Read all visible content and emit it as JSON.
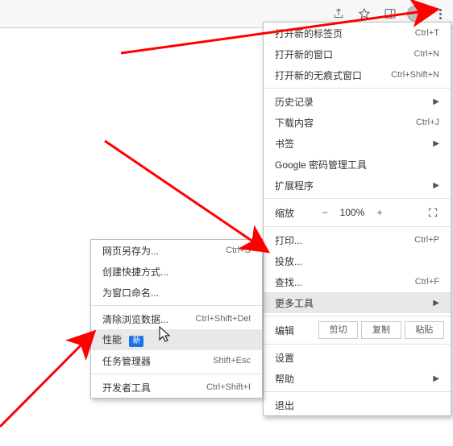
{
  "menu": {
    "new_tab": {
      "label": "打开新的标签页",
      "shortcut": "Ctrl+T"
    },
    "new_window": {
      "label": "打开新的窗口",
      "shortcut": "Ctrl+N"
    },
    "incognito": {
      "label": "打开新的无痕式窗口",
      "shortcut": "Ctrl+Shift+N"
    },
    "history": {
      "label": "历史记录"
    },
    "downloads": {
      "label": "下载内容",
      "shortcut": "Ctrl+J"
    },
    "bookmarks": {
      "label": "书签"
    },
    "pw_manager": {
      "label": "Google 密码管理工具"
    },
    "extensions": {
      "label": "扩展程序"
    },
    "zoom": {
      "label": "缩放",
      "value": "100%",
      "minus": "−",
      "plus": "+"
    },
    "print": {
      "label": "打印...",
      "shortcut": "Ctrl+P"
    },
    "cast": {
      "label": "投放..."
    },
    "find": {
      "label": "查找...",
      "shortcut": "Ctrl+F"
    },
    "more_tools": {
      "label": "更多工具"
    },
    "edit": {
      "label": "编辑",
      "cut": "剪切",
      "copy": "复制",
      "paste": "粘贴"
    },
    "settings": {
      "label": "设置"
    },
    "help": {
      "label": "帮助"
    },
    "exit": {
      "label": "退出"
    }
  },
  "submenu": {
    "save_as": {
      "label": "网页另存为...",
      "shortcut": "Ctrl+S"
    },
    "create_shortcut": {
      "label": "创建快捷方式..."
    },
    "name_window": {
      "label": "为窗口命名..."
    },
    "clear_data": {
      "label": "清除浏览数据...",
      "shortcut": "Ctrl+Shift+Del"
    },
    "performance": {
      "label": "性能",
      "badge": "新"
    },
    "task_manager": {
      "label": "任务管理器",
      "shortcut": "Shift+Esc"
    },
    "dev_tools": {
      "label": "开发者工具",
      "shortcut": "Ctrl+Shift+I"
    }
  }
}
